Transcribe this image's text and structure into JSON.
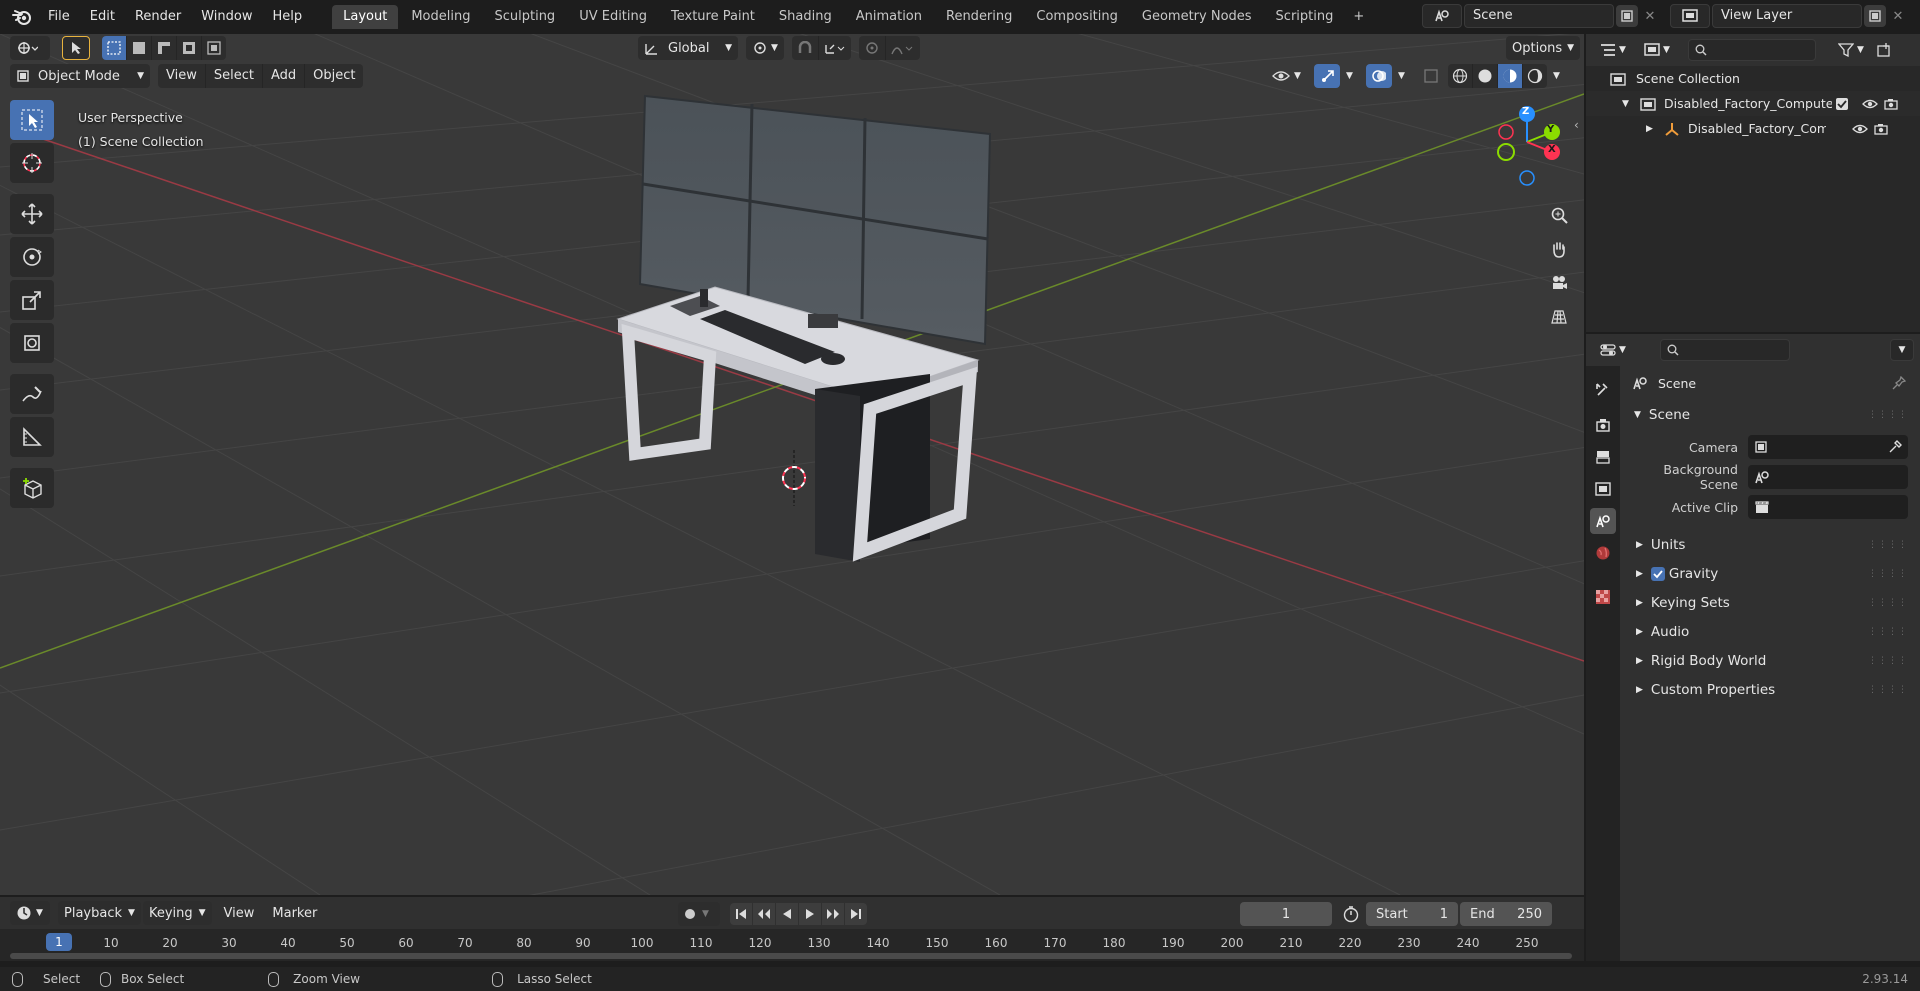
{
  "topbar": {
    "menus": [
      "File",
      "Edit",
      "Render",
      "Window",
      "Help"
    ],
    "workspaces": [
      "Layout",
      "Modeling",
      "Sculpting",
      "UV Editing",
      "Texture Paint",
      "Shading",
      "Animation",
      "Rendering",
      "Compositing",
      "Geometry Nodes",
      "Scripting"
    ],
    "active_workspace": "Layout",
    "scene_name": "Scene",
    "view_layer": "View Layer"
  },
  "viewport": {
    "mode": "Object Mode",
    "menus": [
      "View",
      "Select",
      "Add",
      "Object"
    ],
    "orientation": "Global",
    "options_label": "Options",
    "overlay_line1": "User Perspective",
    "overlay_line2": "(1) Scene Collection",
    "gizmo_axes": [
      "Z",
      "Y",
      "X"
    ]
  },
  "outliner": {
    "root": "Scene Collection",
    "items": [
      {
        "label": "Disabled_Factory_Computer_",
        "level": 1
      },
      {
        "label": "Disabled_Factory_Compu",
        "level": 2
      }
    ]
  },
  "properties": {
    "context": "Scene",
    "panel_title": "Scene",
    "fields": [
      {
        "label": "Camera",
        "value": ""
      },
      {
        "label": "Background Scene",
        "value": ""
      },
      {
        "label": "Active Clip",
        "value": ""
      }
    ],
    "subpanels": [
      "Units",
      "Gravity",
      "Keying Sets",
      "Audio",
      "Rigid Body World",
      "Custom Properties"
    ],
    "gravity_checked": true
  },
  "timeline": {
    "menus": [
      "Playback",
      "Keying",
      "View",
      "Marker"
    ],
    "current_frame": "1",
    "start_label": "Start",
    "start_value": "1",
    "end_label": "End",
    "end_value": "250",
    "ruler_active": "1",
    "ruler": [
      "10",
      "20",
      "30",
      "40",
      "50",
      "60",
      "70",
      "80",
      "90",
      "100",
      "110",
      "120",
      "130",
      "140",
      "150",
      "160",
      "170",
      "180",
      "190",
      "200",
      "210",
      "220",
      "230",
      "240",
      "250"
    ]
  },
  "statusbar": {
    "select": "Select",
    "box_select": "Box Select",
    "zoom_view": "Zoom View",
    "lasso_select": "Lasso Select",
    "version": "2.93.14"
  },
  "colors": {
    "accent": "#4772b3",
    "x_axis": "#ff3352",
    "y_axis": "#8bdc00",
    "z_axis": "#2890ff",
    "viewport_bg": "#393939"
  }
}
